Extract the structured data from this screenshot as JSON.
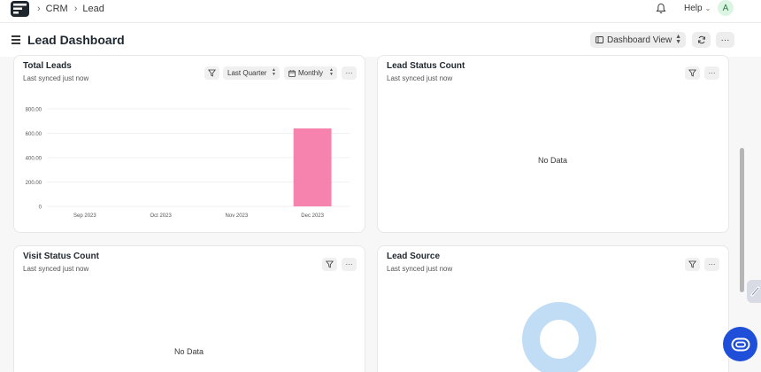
{
  "breadcrumbs": [
    "CRM",
    "Lead"
  ],
  "topbar": {
    "help_label": "Help",
    "avatar_initial": "A"
  },
  "page": {
    "title": "Lead Dashboard",
    "view_label": "Dashboard View"
  },
  "cards": {
    "total_leads": {
      "title": "Total Leads",
      "subtitle": "Last synced just now",
      "time_filter": "Last Quarter",
      "interval": "Monthly"
    },
    "lead_status_count": {
      "title": "Lead Status Count",
      "subtitle": "Last synced just now",
      "empty_text": "No Data"
    },
    "visit_status_count": {
      "title": "Visit Status Count",
      "subtitle": "Last synced just now",
      "empty_text": "No Data"
    },
    "lead_source": {
      "title": "Lead Source",
      "subtitle": "Last synced just now"
    }
  },
  "colors": {
    "bar": "#f683ae",
    "donut": "#c1ddf6",
    "accent": "#1f4fd8"
  },
  "chart_data": {
    "type": "bar",
    "categories": [
      "Sep 2023",
      "Oct 2023",
      "Nov 2023",
      "Dec 2023"
    ],
    "values": [
      0,
      0,
      0,
      640
    ],
    "title": "Total Leads",
    "xlabel": "",
    "ylabel": "",
    "ylim": [
      0,
      800
    ],
    "yticks": [
      "0",
      "200.00",
      "400.00",
      "600.00",
      "800.00"
    ],
    "grid": true,
    "legend": "none"
  }
}
